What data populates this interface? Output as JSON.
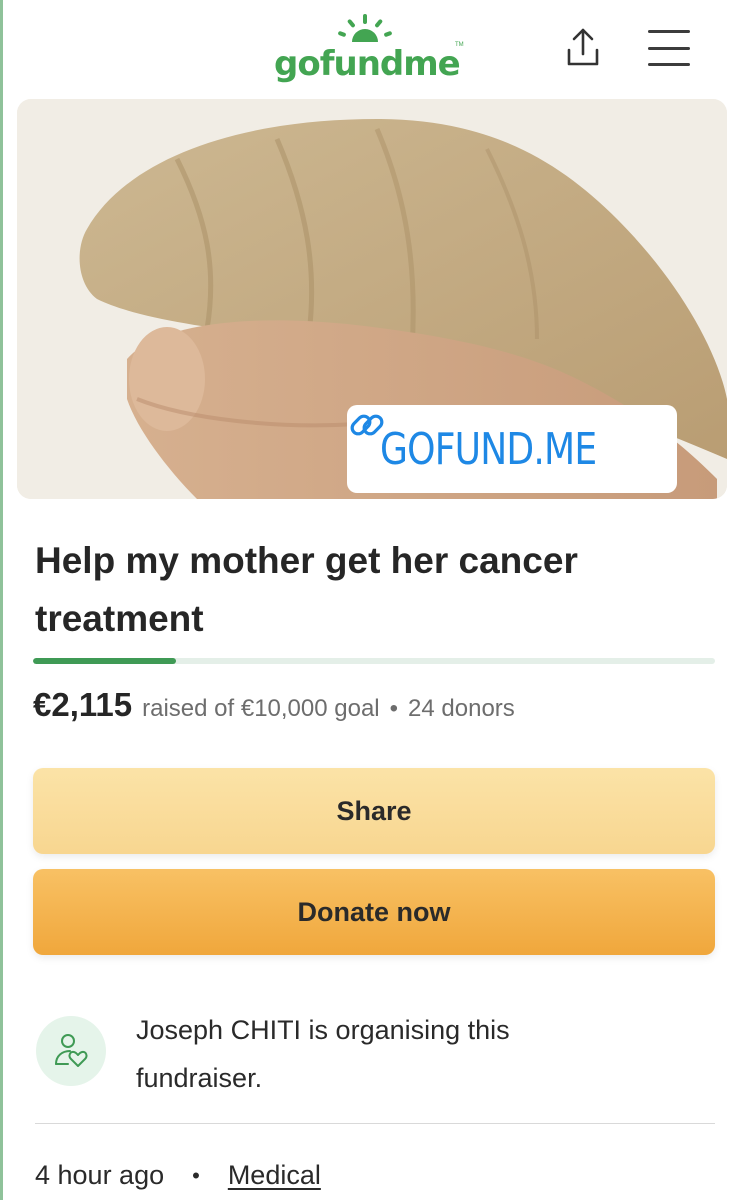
{
  "header": {
    "logo_text": "gofundme",
    "logo_tm": "TM",
    "share_icon": "share-upload-icon",
    "menu_icon": "hamburger-menu-icon"
  },
  "hero": {
    "link_icon": "link-icon",
    "link_label": "GOFUND.ME"
  },
  "campaign": {
    "title": "Help my mother get her cancer treatment",
    "progress_fraction": 0.21,
    "amount_raised": "€2,115",
    "goal_text": "raised of €10,000 goal",
    "separator": "•",
    "donors_text": "24 donors"
  },
  "buttons": {
    "share_label": "Share",
    "donate_label": "Donate now"
  },
  "organiser": {
    "icon": "user-heart-icon",
    "text": "Joseph CHITI is organising this fundraiser."
  },
  "meta": {
    "time": "4 hour ago",
    "separator": "•",
    "category": "Medical"
  },
  "colors": {
    "brand_green": "#43a552",
    "progress_fill": "#3f9a55",
    "share_button": "#f8d690",
    "donate_button": "#f0a73c",
    "link_blue": "#1e88e5"
  }
}
